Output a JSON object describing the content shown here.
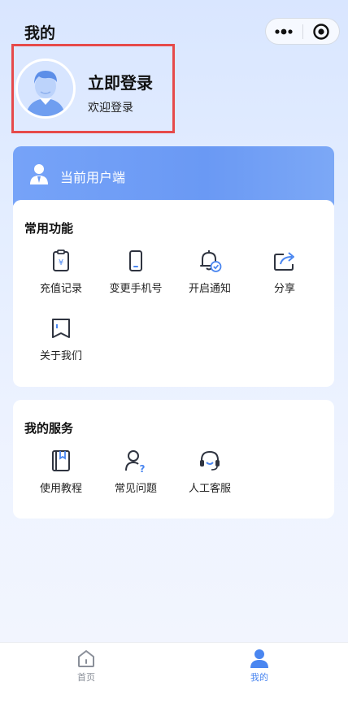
{
  "header": {
    "title": "我的"
  },
  "capsule": {
    "more_icon": "more-dots-icon",
    "close_icon": "target-circle-icon"
  },
  "login": {
    "title": "立即登录",
    "subtitle": "欢迎登录",
    "avatar_icon": "user-avatar-icon"
  },
  "banner": {
    "text": "当前用户端",
    "icon": "user-badge-icon"
  },
  "common": {
    "title": "常用功能",
    "items": [
      {
        "label": "充值记录",
        "icon": "yuan-clipboard-icon"
      },
      {
        "label": "变更手机号",
        "icon": "phone-icon"
      },
      {
        "label": "开启通知",
        "icon": "bell-check-icon"
      },
      {
        "label": "分享",
        "icon": "share-icon"
      },
      {
        "label": "关于我们",
        "icon": "bookmark-book-icon"
      }
    ]
  },
  "services": {
    "title": "我的服务",
    "items": [
      {
        "label": "使用教程",
        "icon": "tutorial-book-icon"
      },
      {
        "label": "常见问题",
        "icon": "user-question-icon"
      },
      {
        "label": "人工客服",
        "icon": "headset-icon"
      }
    ]
  },
  "tabbar": {
    "items": [
      {
        "label": "首页",
        "icon": "home-icon",
        "active": false
      },
      {
        "label": "我的",
        "icon": "person-icon",
        "active": true
      }
    ]
  },
  "colors": {
    "accent": "#4a86f0",
    "banner": "#6a99f4",
    "highlight_border": "#e64a4a",
    "icon_dark": "#2f3440",
    "tab_inactive": "#8a8f99"
  }
}
